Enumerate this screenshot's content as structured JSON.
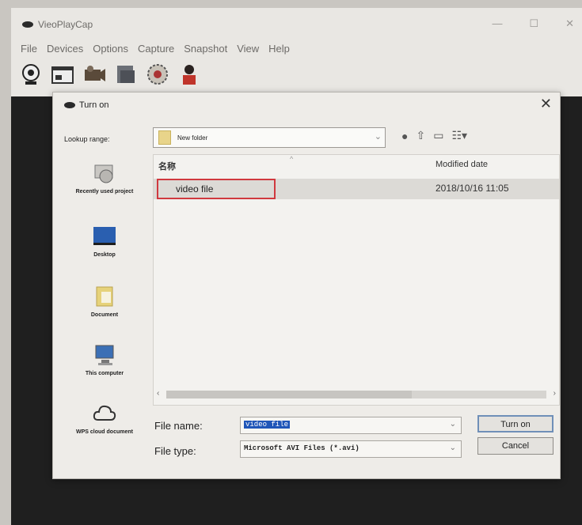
{
  "app": {
    "title": "VieoPlayCap",
    "controls": {
      "minimize": "—",
      "maximize": "☐",
      "close": "✕"
    },
    "menu": [
      "File",
      "Devices",
      "Options",
      "Capture",
      "Snapshot",
      "View",
      "Help"
    ],
    "toolbar_icons": [
      "webcam-icon",
      "video-window-icon",
      "camera-icon",
      "media-file-icon",
      "settings-wheel-icon",
      "user-icon"
    ]
  },
  "dialog": {
    "title": "Turn on",
    "close_glyph": "✕",
    "lookup_label": "Lookup range:",
    "lookup_value": "New folder",
    "places": [
      {
        "label": "Recently used project",
        "icon": "recent-icon"
      },
      {
        "label": "Desktop",
        "icon": "desktop-icon"
      },
      {
        "label": "Document",
        "icon": "document-icon"
      },
      {
        "label": "This computer",
        "icon": "computer-icon"
      },
      {
        "label": "WPS cloud document",
        "icon": "cloud-icon"
      }
    ],
    "columns": {
      "name": "名称",
      "modified": "Modified date"
    },
    "rows": [
      {
        "name": "video file",
        "modified": "2018/10/16 11:05"
      }
    ],
    "file_name_label": "File name:",
    "file_name_value": "video file",
    "file_type_label": "File type:",
    "file_type_value": "Microsoft AVI Files (*.avi)",
    "open_button": "Turn on",
    "cancel_button": "Cancel"
  },
  "colors": {
    "selection": "#1f56b8",
    "highlight_border": "#d0393f",
    "dialog_bg": "#eeece8"
  }
}
